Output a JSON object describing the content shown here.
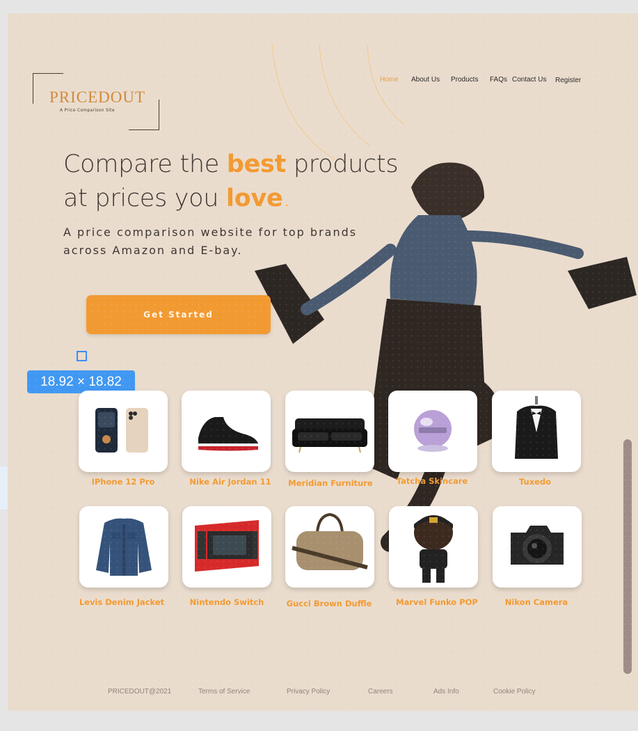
{
  "brand": {
    "name": "PRICEDOUT",
    "tagline": "A Price Comparison Site"
  },
  "nav": {
    "items": [
      "Home",
      "About Us",
      "Products",
      "FAQs",
      "Contact Us",
      "Register"
    ],
    "active": "Home"
  },
  "hero": {
    "headline_a": "Compare the ",
    "headline_b": "best",
    "headline_c": " products",
    "headline_d": "at prices you ",
    "headline_e": "love",
    "headline_f": ".",
    "subtitle": "A price comparison website for top brands across Amazon and E-bay.",
    "cta": "Get Started"
  },
  "measure_tag": "18.92 × 18.82",
  "products": [
    {
      "label": "IPhone 12 Pro",
      "icon": "phone-icon"
    },
    {
      "label": "Nike Air Jordan 11",
      "icon": "sneaker-icon"
    },
    {
      "label": "Meridian Furniture",
      "icon": "sofa-icon"
    },
    {
      "label": "Tatcha Skincare",
      "icon": "skincare-jar-icon"
    },
    {
      "label": "Tuxedo",
      "icon": "tuxedo-icon"
    },
    {
      "label": "Levis Denim Jacket",
      "icon": "jacket-icon"
    },
    {
      "label": "Nintendo Switch",
      "icon": "game-console-icon"
    },
    {
      "label": "Gucci Brown Duffle",
      "icon": "duffle-bag-icon"
    },
    {
      "label": "Marvel Funko POP",
      "icon": "figure-icon"
    },
    {
      "label": "Nikon Camera",
      "icon": "camera-icon"
    }
  ],
  "footer": [
    "PRICEDOUT@2021",
    "Terms of Service",
    "Privacy Policy",
    "Careers",
    "Ads Info",
    "Cookie Policy"
  ],
  "colors": {
    "accent": "#f29a32",
    "background": "#eadccd",
    "text": "#3d3631",
    "selection": "#4198f2"
  }
}
